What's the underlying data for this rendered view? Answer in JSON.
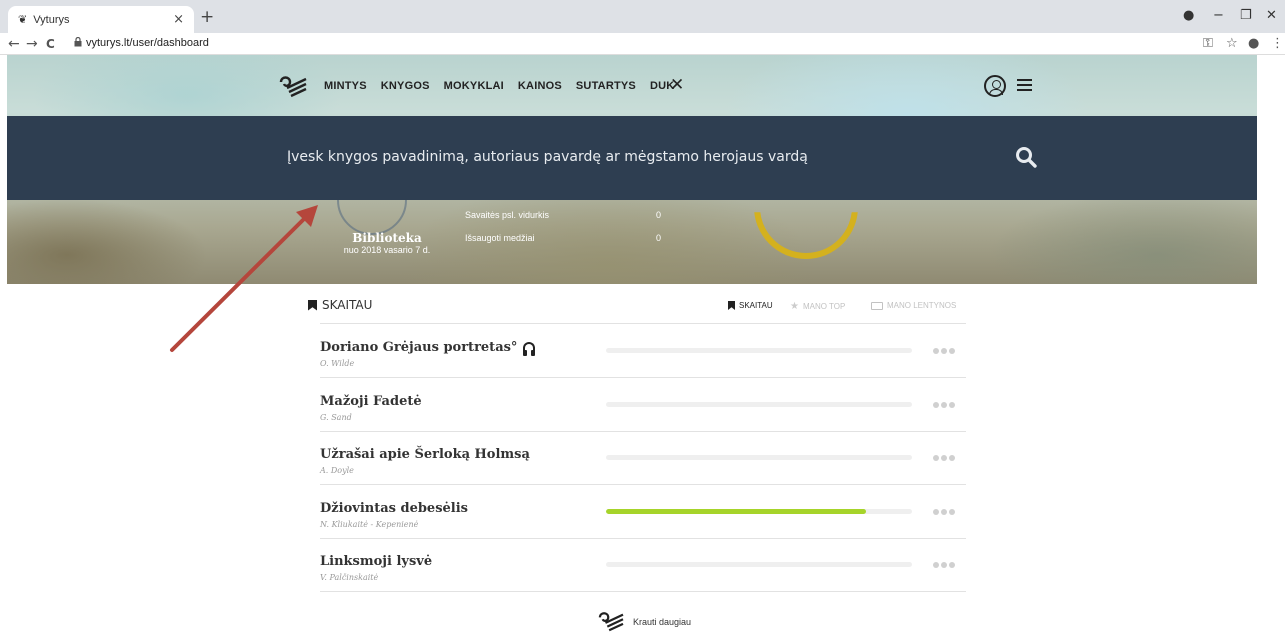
{
  "browser": {
    "tab_title": "Vyturys",
    "tab_favicon": "❦",
    "close_glyph": "×",
    "newtab_glyph": "+",
    "url": "vyturys.lt/user/dashboard",
    "back": "←",
    "forward": "→",
    "reload": "C",
    "minimize": "−",
    "maximize": "❐",
    "close_window": "✕",
    "key_glyph": "⚿",
    "star_glyph": "☆",
    "menu_glyph": "⋮"
  },
  "nav": {
    "items": [
      "MINTYS",
      "KNYGOS",
      "MOKYKLAI",
      "KAINOS",
      "SUTARTYS",
      "DUK"
    ],
    "close_glyph": "✕"
  },
  "search": {
    "placeholder": "Įvesk knygos pavadinimą, autoriaus pavardę ar mėgstamo herojaus vardą"
  },
  "library": {
    "title": "Biblioteka",
    "since": "nuo 2018 vasario 7 d.",
    "stats": [
      {
        "label": "Savaitės psl. vidurkis",
        "value": "0"
      },
      {
        "label": "Išsaugoti medžiai",
        "value": "0"
      }
    ]
  },
  "reading": {
    "title": "SKAITAU",
    "tabs": [
      {
        "label": "SKAITAU",
        "active": true
      },
      {
        "label": "MANO TOP",
        "active": false
      },
      {
        "label": "MANO LENTYNOS",
        "active": false
      }
    ],
    "books": [
      {
        "title": "Doriano Grėjaus portretas°",
        "author": "O. Wilde",
        "audio": true,
        "progress": 0
      },
      {
        "title": "Mažoji Fadetė",
        "author": "G. Sand",
        "audio": false,
        "progress": 0
      },
      {
        "title": "Užrašai apie Šerloką Holmsą",
        "author": "A. Doyle",
        "audio": false,
        "progress": 0
      },
      {
        "title": "Džiovintas debesėlis",
        "author": "N. Kliukaitė - Kepenienė",
        "audio": false,
        "progress": 0.85
      },
      {
        "title": "Linksmoji lysvė",
        "author": "V. Palčinskaitė",
        "audio": false,
        "progress": 0
      }
    ],
    "load_more": "Krauti daugiau"
  },
  "colors": {
    "search_bg": "#2e3e51",
    "progress_fill": "#a6d42a",
    "annotation_arrow": "#b5463c"
  }
}
